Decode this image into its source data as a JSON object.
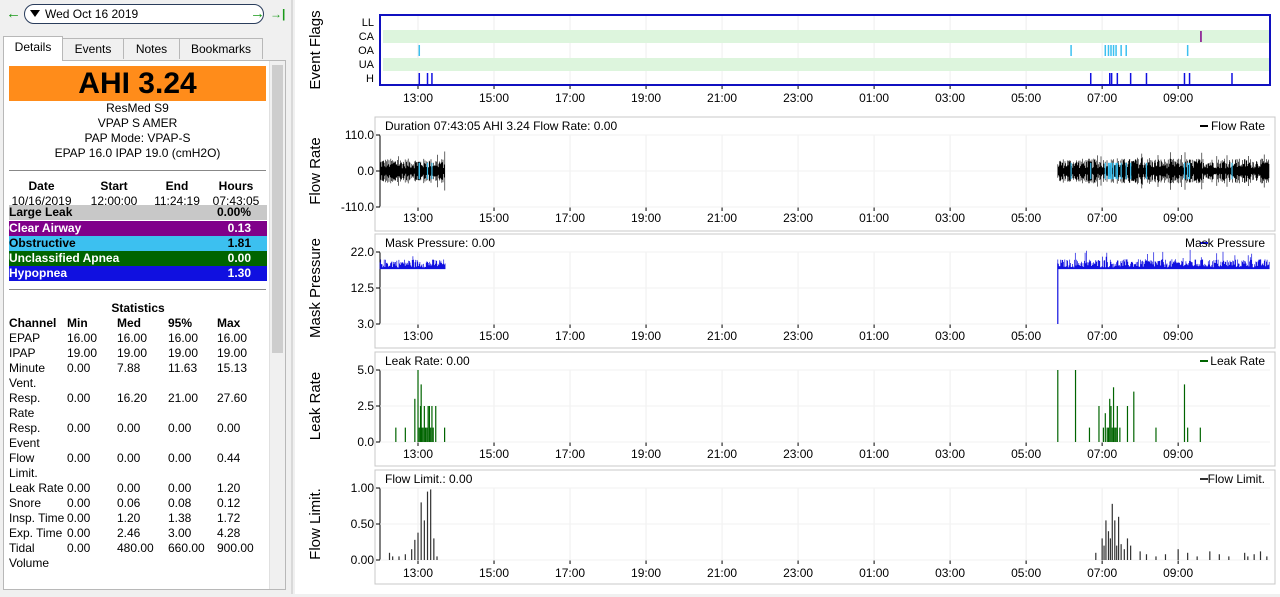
{
  "nav": {
    "prev_icon": "←",
    "date": "Wed Oct 16 2019",
    "next_icon": "→",
    "last_icon": "→|"
  },
  "tabs": [
    "Details",
    "Events",
    "Notes",
    "Bookmarks"
  ],
  "details": {
    "ahi": "AHI 3.24",
    "device": [
      "ResMed S9",
      "VPAP S AMER",
      "PAP Mode: VPAP-S",
      "EPAP 16.0 IPAP 19.0 (cmH2O)"
    ],
    "session_headers": [
      "Date",
      "Start",
      "End",
      "Hours"
    ],
    "session_values": [
      "10/16/2019",
      "12:00:00",
      "11:24:19",
      "07:43:05"
    ],
    "events": [
      {
        "label": "Large Leak",
        "value": "0.00%",
        "bg": "#c8c8c8",
        "fg": "#000000"
      },
      {
        "label": "Clear Airway",
        "value": "0.13",
        "bg": "#80008a",
        "fg": "#ffffff"
      },
      {
        "label": "Obstructive",
        "value": "1.81",
        "bg": "#3cc0f0",
        "fg": "#000000"
      },
      {
        "label": "Unclassified Apnea",
        "value": "0.00",
        "bg": "#006400",
        "fg": "#ffffff"
      },
      {
        "label": "Hypopnea",
        "value": "1.30",
        "bg": "#1010e0",
        "fg": "#ffffff"
      }
    ],
    "stats_title": "Statistics",
    "stats_headers": [
      "Channel",
      "Min",
      "Med",
      "95%",
      "Max"
    ],
    "stats_rows": [
      {
        "name": [
          "EPAP"
        ],
        "vals": [
          "16.00",
          "16.00",
          "16.00",
          "16.00"
        ]
      },
      {
        "name": [
          "IPAP"
        ],
        "vals": [
          "19.00",
          "19.00",
          "19.00",
          "19.00"
        ]
      },
      {
        "name": [
          "Minute",
          "Vent."
        ],
        "vals": [
          "0.00",
          "7.88",
          "11.63",
          "15.13"
        ]
      },
      {
        "name": [
          "Resp.",
          "Rate"
        ],
        "vals": [
          "0.00",
          "16.20",
          "21.00",
          "27.60"
        ]
      },
      {
        "name": [
          "Resp.",
          "Event"
        ],
        "vals": [
          "0.00",
          "0.00",
          "0.00",
          "0.00"
        ]
      },
      {
        "name": [
          "Flow",
          "Limit."
        ],
        "vals": [
          "0.00",
          "0.00",
          "0.00",
          "0.44"
        ]
      },
      {
        "name": [
          "Leak Rate"
        ],
        "vals": [
          "0.00",
          "0.00",
          "0.00",
          "1.20"
        ]
      },
      {
        "name": [
          "Snore"
        ],
        "vals": [
          "0.00",
          "0.06",
          "0.08",
          "0.12"
        ]
      },
      {
        "name": [
          "Insp. Time"
        ],
        "vals": [
          "0.00",
          "1.20",
          "1.38",
          "1.72"
        ]
      },
      {
        "name": [
          "Exp. Time"
        ],
        "vals": [
          "0.00",
          "2.46",
          "3.00",
          "4.28"
        ]
      },
      {
        "name": [
          "Tidal",
          "Volume"
        ],
        "vals": [
          "0.00",
          "480.00",
          "660.00",
          "900.00"
        ]
      }
    ]
  },
  "time_axis": {
    "ticks": [
      "13:00",
      "15:00",
      "17:00",
      "19:00",
      "21:00",
      "23:00",
      "01:00",
      "03:00",
      "05:00",
      "07:00",
      "09:00"
    ]
  },
  "colors": {
    "flag_band": "#ddf5dd",
    "border": "#1010c0",
    "obstructive": "#3cc0f0",
    "hypopnea": "#1010e0",
    "clear_airway": "#80008a",
    "leak": "#006400",
    "flow": "#000000",
    "pressure": "#1010e0",
    "flowlimit": "#303030"
  },
  "chart_data": [
    {
      "type": "event-flags",
      "ylabel": "Event Flags",
      "rows": [
        "LL",
        "CA",
        "OA",
        "UA",
        "H"
      ],
      "events": {
        "CA": [
          "09:36"
        ],
        "OA": [
          "13:02",
          "06:11",
          "07:05",
          "07:10",
          "07:14",
          "07:18",
          "07:22",
          "07:30",
          "07:38",
          "09:15"
        ],
        "H": [
          "13:02",
          "13:15",
          "13:22",
          "06:42",
          "07:12",
          "07:15",
          "07:24",
          "07:45",
          "08:10",
          "09:10",
          "09:18",
          "10:25"
        ]
      }
    },
    {
      "type": "line",
      "ylabel": "Flow Rate",
      "title": "Duration 07:43:05 AHI 3.24 Flow Rate: 0.00",
      "legend": "Flow Rate",
      "ylim": [
        -110,
        110
      ],
      "yticks": [
        "110.0",
        "0.0",
        "-110.0"
      ],
      "segments": [
        [
          "12:00",
          "13:43"
        ],
        [
          "05:50",
          "11:24"
        ]
      ]
    },
    {
      "type": "line",
      "ylabel": "Mask Pressure",
      "title": "Mask Pressure: 0.00",
      "legend": "Mask Pressure",
      "ylim": [
        3,
        22
      ],
      "yticks": [
        "22.0",
        "12.5",
        "3.0"
      ],
      "segments": [
        [
          "12:00",
          "13:43"
        ],
        [
          "05:50",
          "11:24"
        ]
      ],
      "level": 19,
      "baseline": 3
    },
    {
      "type": "bar",
      "ylabel": "Leak Rate",
      "title": "Leak Rate: 0.00",
      "legend": "Leak Rate",
      "ylim": [
        0,
        5
      ],
      "yticks": [
        "5.0",
        "2.5",
        "0.0"
      ],
      "bars": [
        [
          "12:25",
          1.0
        ],
        [
          "12:40",
          1.0
        ],
        [
          "12:55",
          3.0
        ],
        [
          "13:00",
          5.0
        ],
        [
          "13:02",
          1.0
        ],
        [
          "13:04",
          2.5
        ],
        [
          "13:05",
          4.0
        ],
        [
          "13:06",
          1.0
        ],
        [
          "13:08",
          1.0
        ],
        [
          "13:10",
          2.5
        ],
        [
          "13:12",
          1.0
        ],
        [
          "13:14",
          1.0
        ],
        [
          "13:16",
          2.5
        ],
        [
          "13:18",
          2.5
        ],
        [
          "13:20",
          1.0
        ],
        [
          "13:22",
          2.5
        ],
        [
          "13:24",
          1.0
        ],
        [
          "13:28",
          2.5
        ],
        [
          "13:42",
          1.0
        ],
        [
          "05:50",
          5.0
        ],
        [
          "06:18",
          5.0
        ],
        [
          "06:40",
          1.0
        ],
        [
          "06:55",
          2.5
        ],
        [
          "07:02",
          1.0
        ],
        [
          "07:05",
          2.0
        ],
        [
          "07:08",
          1.0
        ],
        [
          "07:10",
          1.0
        ],
        [
          "07:12",
          3.0
        ],
        [
          "07:14",
          2.5
        ],
        [
          "07:16",
          1.0
        ],
        [
          "07:18",
          3.8
        ],
        [
          "07:20",
          1.0
        ],
        [
          "07:22",
          1.0
        ],
        [
          "07:24",
          2.5
        ],
        [
          "07:28",
          1.0
        ],
        [
          "07:40",
          2.5
        ],
        [
          "07:50",
          3.5
        ],
        [
          "08:25",
          1.0
        ],
        [
          "09:10",
          4.0
        ],
        [
          "09:15",
          1.0
        ],
        [
          "09:35",
          1.0
        ]
      ]
    },
    {
      "type": "bar",
      "ylabel": "Flow Limit.",
      "title": "Flow Limit.: 0.00",
      "legend": "Flow Limit.",
      "ylim": [
        0,
        1
      ],
      "yticks": [
        "1.00",
        "0.50",
        "0.00"
      ],
      "bars": [
        [
          "12:15",
          0.1
        ],
        [
          "12:20",
          0.05
        ],
        [
          "12:30",
          0.05
        ],
        [
          "12:40",
          0.08
        ],
        [
          "12:50",
          0.15
        ],
        [
          "12:55",
          0.28
        ],
        [
          "13:00",
          0.38
        ],
        [
          "13:05",
          0.8
        ],
        [
          "13:10",
          0.55
        ],
        [
          "13:15",
          0.95
        ],
        [
          "13:20",
          0.98
        ],
        [
          "13:25",
          0.3
        ],
        [
          "13:30",
          0.05
        ],
        [
          "06:50",
          0.1
        ],
        [
          "07:00",
          0.3
        ],
        [
          "07:03",
          0.2
        ],
        [
          "07:06",
          0.55
        ],
        [
          "07:10",
          0.4
        ],
        [
          "07:13",
          0.3
        ],
        [
          "07:16",
          0.78
        ],
        [
          "07:20",
          0.55
        ],
        [
          "07:23",
          0.2
        ],
        [
          "07:26",
          0.6
        ],
        [
          "07:30",
          0.22
        ],
        [
          "07:35",
          0.15
        ],
        [
          "07:40",
          0.3
        ],
        [
          "07:45",
          0.2
        ],
        [
          "08:00",
          0.12
        ],
        [
          "08:10",
          0.08
        ],
        [
          "08:25",
          0.05
        ],
        [
          "08:40",
          0.08
        ],
        [
          "09:00",
          0.15
        ],
        [
          "09:15",
          0.1
        ],
        [
          "09:30",
          0.05
        ],
        [
          "09:50",
          0.12
        ],
        [
          "10:05",
          0.08
        ],
        [
          "10:20",
          0.05
        ],
        [
          "10:45",
          0.1
        ],
        [
          "10:50",
          0.05
        ],
        [
          "11:00",
          0.08
        ],
        [
          "11:10",
          0.12
        ],
        [
          "11:20",
          0.05
        ]
      ]
    }
  ]
}
